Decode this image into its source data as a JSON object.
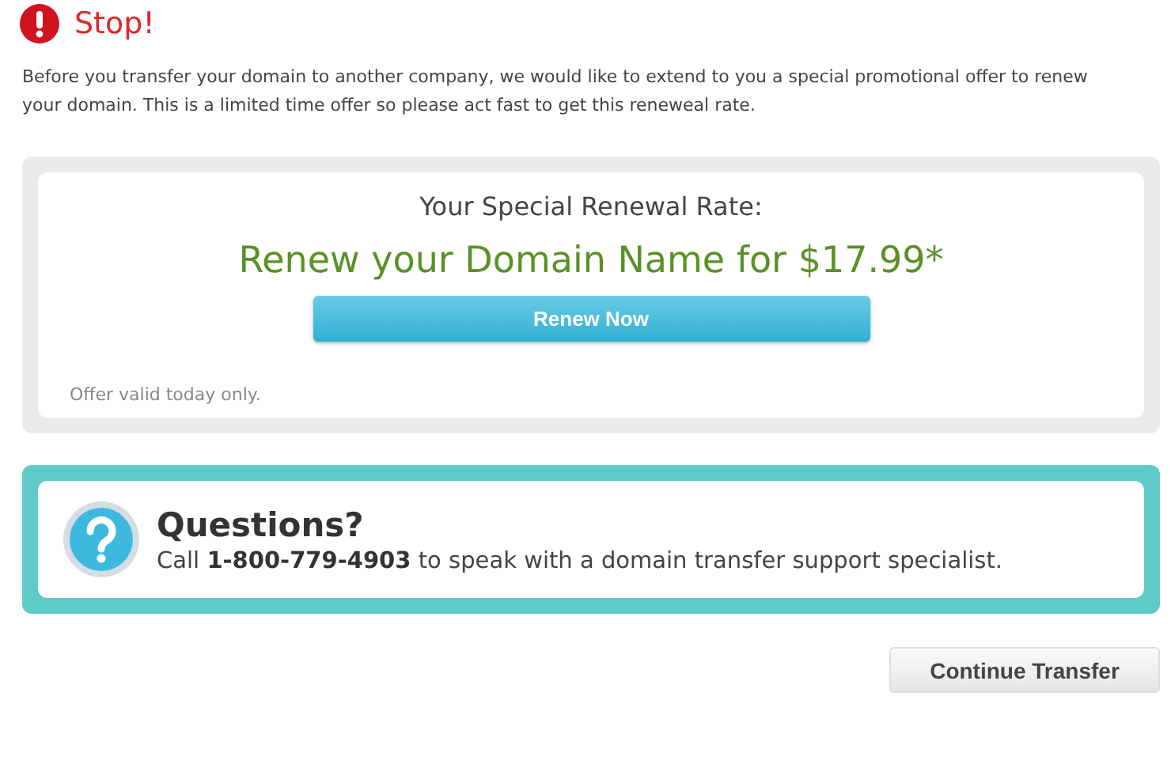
{
  "heading": "Stop!",
  "intro": "Before you transfer your domain to another company, we would like to extend to you a special promotional offer to renew your domain. This is a limited time offer so please act fast to get this reneweal rate.",
  "offer": {
    "title": "Your Special Renewal Rate:",
    "headline": "Renew your Domain Name for $17.99*",
    "button": "Renew Now",
    "note": "Offer valid today only."
  },
  "questions": {
    "title": "Questions?",
    "text": "Call **1-800-779-4903** to speak with a domain transfer support specialist."
  },
  "continue_button": "Continue Transfer"
}
